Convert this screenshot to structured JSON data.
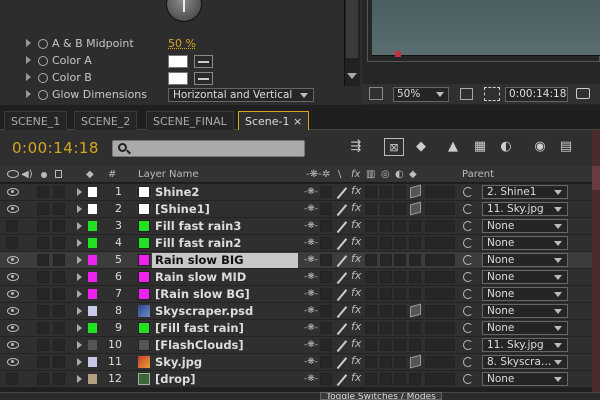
{
  "effect_controls": {
    "properties": [
      {
        "label": "A & B Midpoint",
        "value": "50 %",
        "type": "value"
      },
      {
        "label": "Color A",
        "type": "color",
        "color": "#ffffff"
      },
      {
        "label": "Color B",
        "type": "color",
        "color": "#ffffff"
      },
      {
        "label": "Glow Dimensions",
        "type": "select",
        "value": "Horizontal and Vertical"
      }
    ]
  },
  "viewer": {
    "zoom": "50%",
    "timecode": "0:00:14:18"
  },
  "tabs": [
    {
      "label": "SCENE_1",
      "active": false
    },
    {
      "label": "SCENE_2",
      "active": false
    },
    {
      "label": "SCENE_FINAL",
      "active": false
    },
    {
      "label": "Scene-1",
      "active": true,
      "close": "×"
    }
  ],
  "timeline": {
    "timecode": "0:00:14:18",
    "columns": {
      "number": "#",
      "layer_name": "Layer Name",
      "parent": "Parent"
    },
    "layers": [
      {
        "num": "1",
        "name": "Shine2",
        "label_color": "#ffffff",
        "parent": "2. Shine1",
        "eye": true,
        "selected": false,
        "thumb": "",
        "cube": true
      },
      {
        "num": "2",
        "name": "[Shine1]",
        "label_color": "#ffffff",
        "parent": "11. Sky.jpg",
        "eye": true,
        "selected": false,
        "thumb": "",
        "cube": true
      },
      {
        "num": "3",
        "name": "Fill fast rain3",
        "label_color": "#22e022",
        "parent": "None",
        "eye": false,
        "selected": false,
        "thumb": "",
        "cube": false
      },
      {
        "num": "4",
        "name": "Fill fast rain2",
        "label_color": "#22e022",
        "parent": "None",
        "eye": false,
        "selected": false,
        "thumb": "",
        "cube": false
      },
      {
        "num": "5",
        "name": "Rain slow BIG",
        "label_color": "#ee22ee",
        "parent": "None",
        "eye": true,
        "selected": true,
        "thumb": "",
        "cube": false
      },
      {
        "num": "6",
        "name": "Rain slow MID",
        "label_color": "#ee22ee",
        "parent": "None",
        "eye": true,
        "selected": false,
        "thumb": "",
        "cube": false
      },
      {
        "num": "7",
        "name": "[Rain slow BG]",
        "label_color": "#ee22ee",
        "parent": "None",
        "eye": true,
        "selected": false,
        "thumb": "",
        "cube": false
      },
      {
        "num": "8",
        "name": "Skyscraper.psd",
        "label_color": "#c8c8e8",
        "parent": "None",
        "eye": true,
        "selected": false,
        "thumb": "psd",
        "cube": true
      },
      {
        "num": "9",
        "name": "[Fill fast rain]",
        "label_color": "#22e022",
        "parent": "None",
        "eye": true,
        "selected": false,
        "thumb": "",
        "cube": false
      },
      {
        "num": "10",
        "name": "[FlashClouds]",
        "label_color": "#555555",
        "parent": "11. Sky.jpg",
        "eye": true,
        "selected": false,
        "thumb": "",
        "cube": false
      },
      {
        "num": "11",
        "name": "Sky.jpg",
        "label_color": "#c8c8e8",
        "parent": "8. Skyscra…",
        "eye": true,
        "selected": false,
        "thumb": "jpg",
        "cube": true
      },
      {
        "num": "12",
        "name": "[drop]",
        "label_color": "#b0a080",
        "parent": "None",
        "eye": false,
        "selected": false,
        "thumb": "comp",
        "cube": false
      }
    ]
  },
  "footer": {
    "toggle_label": "Toggle Switches / Modes"
  },
  "colors": {
    "accent": "#d6a520",
    "panel": "#2f2f2f",
    "selection": "#c8c8c8"
  }
}
